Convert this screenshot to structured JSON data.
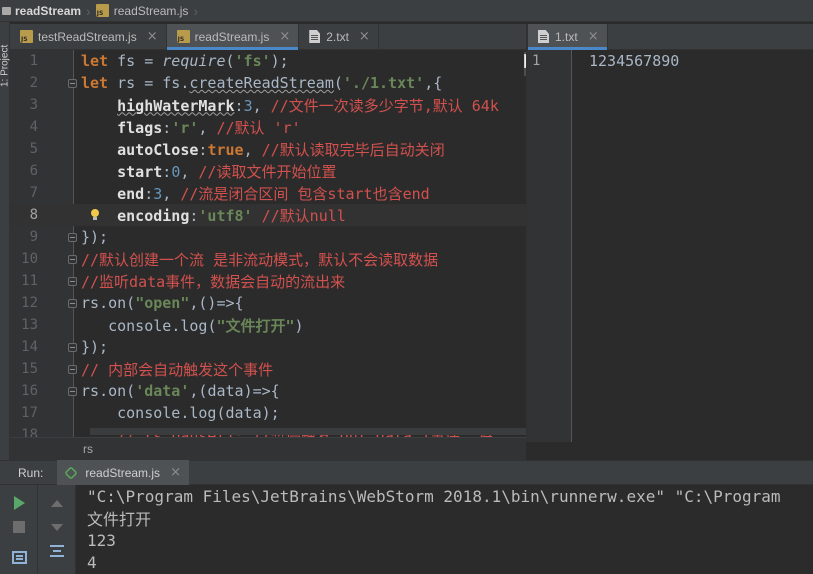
{
  "breadcrumb": {
    "project": "readStream",
    "file": "readStream.js"
  },
  "left_toolwindow": {
    "label": "1: Project"
  },
  "editor_tabs": [
    {
      "label": "testReadStream.js",
      "type": "js",
      "active": false
    },
    {
      "label": "readStream.js",
      "type": "js",
      "active": true
    },
    {
      "label": "2.txt",
      "type": "txt",
      "active": false
    }
  ],
  "right_tabs": [
    {
      "label": "1.txt",
      "type": "txt",
      "active": true
    }
  ],
  "code_lines": [
    {
      "n": "1",
      "segments": [
        {
          "t": "let ",
          "c": "kw"
        },
        {
          "t": "fs",
          "c": "var"
        },
        {
          "t": " = ",
          "c": "var"
        },
        {
          "t": "require",
          "c": "it"
        },
        {
          "t": "(",
          "c": "var"
        },
        {
          "t": "'fs'",
          "c": "str"
        },
        {
          "t": ");",
          "c": "var"
        }
      ]
    },
    {
      "n": "2",
      "segments": [
        {
          "t": "let ",
          "c": "kw"
        },
        {
          "t": "rs",
          "c": "var"
        },
        {
          "t": " = ",
          "c": "var"
        },
        {
          "t": "fs",
          "c": "var"
        },
        {
          "t": ".",
          "c": "var"
        },
        {
          "t": "createReadStream",
          "c": "fn-u"
        },
        {
          "t": "(",
          "c": "var"
        },
        {
          "t": "'./1.txt'",
          "c": "str"
        },
        {
          "t": ",{",
          "c": "var"
        }
      ]
    },
    {
      "n": "3",
      "segments": [
        {
          "t": "    ",
          "c": "var"
        },
        {
          "t": "highWaterMark",
          "c": "prop-u"
        },
        {
          "t": ":",
          "c": "var"
        },
        {
          "t": "3",
          "c": "num"
        },
        {
          "t": ", ",
          "c": "var"
        },
        {
          "t": "//文件一次读多少字节,默认 64k",
          "c": "cmt"
        }
      ]
    },
    {
      "n": "4",
      "segments": [
        {
          "t": "    ",
          "c": "var"
        },
        {
          "t": "flags",
          "c": "prop"
        },
        {
          "t": ":",
          "c": "var"
        },
        {
          "t": "'r'",
          "c": "str"
        },
        {
          "t": ", ",
          "c": "var"
        },
        {
          "t": "//默认 'r'",
          "c": "cmt"
        }
      ]
    },
    {
      "n": "5",
      "segments": [
        {
          "t": "    ",
          "c": "var"
        },
        {
          "t": "autoClose",
          "c": "prop"
        },
        {
          "t": ":",
          "c": "var"
        },
        {
          "t": "true",
          "c": "bool"
        },
        {
          "t": ", ",
          "c": "var"
        },
        {
          "t": "//默认读取完毕后自动关闭",
          "c": "cmt"
        }
      ]
    },
    {
      "n": "6",
      "segments": [
        {
          "t": "    ",
          "c": "var"
        },
        {
          "t": "start",
          "c": "prop"
        },
        {
          "t": ":",
          "c": "var"
        },
        {
          "t": "0",
          "c": "num"
        },
        {
          "t": ", ",
          "c": "var"
        },
        {
          "t": "//读取文件开始位置",
          "c": "cmt"
        }
      ]
    },
    {
      "n": "7",
      "segments": [
        {
          "t": "    ",
          "c": "var"
        },
        {
          "t": "end",
          "c": "prop"
        },
        {
          "t": ":",
          "c": "var"
        },
        {
          "t": "3",
          "c": "num"
        },
        {
          "t": ", ",
          "c": "var"
        },
        {
          "t": "//流是闭合区间 包含start也含end",
          "c": "cmt"
        }
      ]
    },
    {
      "n": "8",
      "segments": [
        {
          "t": "    ",
          "c": "var"
        },
        {
          "t": "encoding",
          "c": "prop"
        },
        {
          "t": ":",
          "c": "var"
        },
        {
          "t": "'utf8'",
          "c": "str"
        },
        {
          "t": " ",
          "c": "var"
        },
        {
          "t": "//默认null",
          "c": "cmt"
        }
      ]
    },
    {
      "n": "9",
      "segments": [
        {
          "t": "});",
          "c": "var"
        }
      ]
    },
    {
      "n": "10",
      "segments": [
        {
          "t": "//默认创建一个流 是非流动模式，默认不会读取数据",
          "c": "cmt"
        }
      ]
    },
    {
      "n": "11",
      "segments": [
        {
          "t": "//监听data事件，数据会自动的流出来",
          "c": "cmt"
        }
      ]
    },
    {
      "n": "12",
      "segments": [
        {
          "t": "rs",
          "c": "var"
        },
        {
          "t": ".",
          "c": "var"
        },
        {
          "t": "on",
          "c": "var"
        },
        {
          "t": "(",
          "c": "var"
        },
        {
          "t": "\"open\"",
          "c": "str"
        },
        {
          "t": ",()=>{",
          "c": "var"
        }
      ]
    },
    {
      "n": "13",
      "segments": [
        {
          "t": "   console",
          "c": "var"
        },
        {
          "t": ".",
          "c": "var"
        },
        {
          "t": "log",
          "c": "var"
        },
        {
          "t": "(",
          "c": "var"
        },
        {
          "t": "\"文件打开\"",
          "c": "str"
        },
        {
          "t": ")",
          "c": "var"
        }
      ]
    },
    {
      "n": "14",
      "segments": [
        {
          "t": "});",
          "c": "var"
        }
      ]
    },
    {
      "n": "15",
      "segments": [
        {
          "t": "// 内部会自动触发这个事件",
          "c": "cmt"
        }
      ]
    },
    {
      "n": "16",
      "segments": [
        {
          "t": "rs",
          "c": "var"
        },
        {
          "t": ".",
          "c": "var"
        },
        {
          "t": "on",
          "c": "var"
        },
        {
          "t": "(",
          "c": "var"
        },
        {
          "t": "'data'",
          "c": "str"
        },
        {
          "t": ",(",
          "c": "var"
        },
        {
          "t": "data",
          "c": "var"
        },
        {
          "t": ")=>{",
          "c": "var"
        }
      ]
    },
    {
      "n": "17",
      "segments": [
        {
          "t": "    console",
          "c": "var"
        },
        {
          "t": ".",
          "c": "var"
        },
        {
          "t": "log",
          "c": "var"
        },
        {
          "t": "(",
          "c": "var"
        },
        {
          "t": "data",
          "c": "var"
        },
        {
          "t": ");",
          "c": "var"
        }
      ]
    },
    {
      "n": "18",
      "segments": [
        {
          "t": "    // rs.pause(); //暂停触发 on(\"data\")事件, 将",
          "c": "cmt"
        }
      ]
    }
  ],
  "current_line": "8",
  "editor_breadcrumb": "rs",
  "right_editor": {
    "line_number": "1",
    "content": "1234567890"
  },
  "run_panel": {
    "label": "Run:",
    "tab_label": "readStream.js",
    "output": [
      "\"C:\\Program Files\\JetBrains\\WebStorm 2018.1\\bin\\runnerw.exe\" \"C:\\Program",
      "文件打开",
      "123",
      "4"
    ]
  },
  "icons": {
    "tab_js": "js-file-icon",
    "tab_txt": "text-file-icon",
    "run": "play-icon",
    "stop": "stop-icon",
    "up": "arrow-up-icon",
    "down": "arrow-down-icon",
    "soft_wrap": "soft-wrap-icon",
    "layout": "layout-icon",
    "bulb": "intention-bulb-icon",
    "node": "nodejs-icon"
  },
  "colors": {
    "accent_tab": "#4a88c7",
    "keyword": "#cc7832",
    "string": "#6a8759",
    "number": "#6897bb",
    "comment": "#d2514e",
    "run_green": "#59a869"
  }
}
